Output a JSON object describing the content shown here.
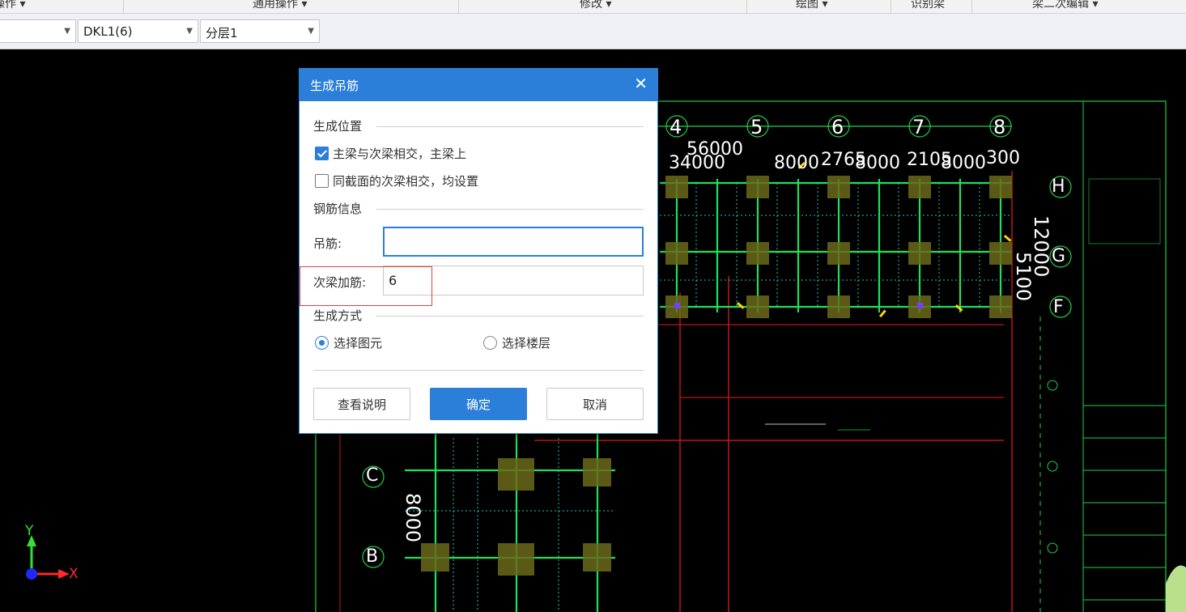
{
  "ribbon": {
    "groups": [
      "操作 ▾",
      "通用操作 ▾",
      "修改 ▾",
      "绘图 ▾",
      "识别梁",
      "梁二次编辑 ▾"
    ]
  },
  "combos": [
    {
      "value": ""
    },
    {
      "value": "DKL1(6)"
    },
    {
      "value": "分层1"
    }
  ],
  "dialog": {
    "title": "生成吊筋",
    "close": "✕",
    "section_position": "生成位置",
    "opt_main_beam": "主梁与次梁相交，主梁上",
    "opt_main_beam_checked": true,
    "opt_same_section": "同截面的次梁相交，均设置",
    "opt_same_section_checked": false,
    "section_rebar": "钢筋信息",
    "hanger_label": "吊筋:",
    "hanger_value": "",
    "secondary_label": "次梁加筋:",
    "secondary_value": "6",
    "section_method": "生成方式",
    "radio_element": "选择图元",
    "radio_floor": "选择楼层",
    "radio_selected": "选择图元",
    "btn_help": "查看说明",
    "btn_ok": "确定",
    "btn_cancel": "取消"
  },
  "cad": {
    "grid_numbers": [
      "4",
      "5",
      "6",
      "7",
      "8"
    ],
    "grid_letters_right": [
      "H",
      "G",
      "F"
    ],
    "grid_letters_left": [
      "C",
      "B"
    ],
    "dims_top": [
      "56000",
      "34000",
      "8000",
      "2765",
      "8000",
      "2105",
      "8000",
      "300"
    ],
    "dim_left_vertical": "8000",
    "dim_right_vertical_a": "12000",
    "dim_right_vertical_b": "5100"
  },
  "axis": {
    "y": "Y",
    "x": "X"
  },
  "colors": {
    "accent": "#2b7fd9",
    "cad_green": "#1fe05a",
    "cad_red": "#c0151a"
  }
}
